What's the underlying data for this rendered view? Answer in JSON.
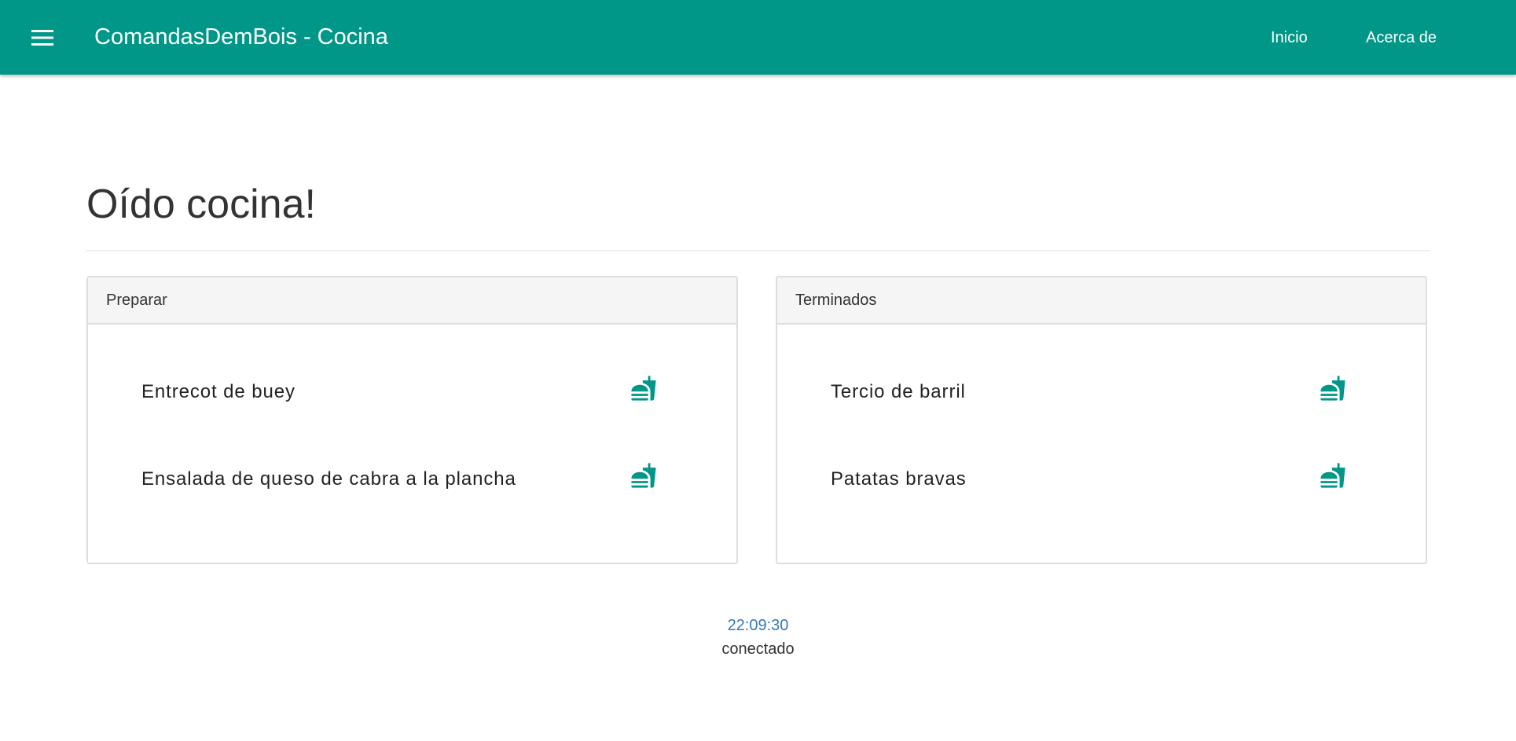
{
  "toolbar": {
    "menu_icon": "hamburger-menu-icon",
    "title": "ComandasDemBois - Cocina",
    "nav": {
      "inicio": "Inicio",
      "acerca": "Acerca de"
    },
    "color": "#009688"
  },
  "main": {
    "title": "Oído cocina!"
  },
  "panels": {
    "preparar": {
      "heading": "Preparar",
      "items": [
        {
          "name": "Entrecot de buey",
          "icon": "fastfood-icon"
        },
        {
          "name": "Ensalada de queso de cabra a la plancha",
          "icon": "fastfood-icon"
        }
      ]
    },
    "terminados": {
      "heading": "Terminados",
      "items": [
        {
          "name": "Tercio de barril",
          "icon": "fastfood-icon"
        },
        {
          "name": "Patatas bravas",
          "icon": "fastfood-icon"
        }
      ]
    }
  },
  "status": {
    "time": "22:09:30",
    "connection": "conectado"
  },
  "colors": {
    "accent": "#009688",
    "time": "#337ab7",
    "panel_heading_bg": "#f5f5f5"
  }
}
